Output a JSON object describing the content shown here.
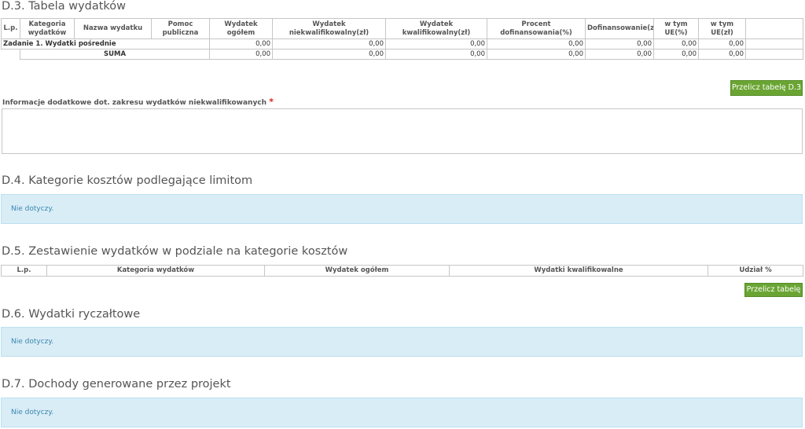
{
  "d3": {
    "title": "D.3. Tabela wydatków",
    "headers": [
      "L.p.",
      "Kategoria wydatków",
      "Nazwa wydatku",
      "Pomoc publiczna",
      "Wydatek ogółem",
      "Wydatek niekwalifikowalny(zł)",
      "Wydatek kwalifikowalny(zł)",
      "Procent dofinansowania(%)",
      "Dofinansowanie(zł)",
      "w tym UE(%)",
      "w tym UE(zł)"
    ],
    "task_row": {
      "label": "Zadanie 1. Wydatki pośrednie",
      "values": [
        "0,00",
        "0,00",
        "0,00",
        "0,00",
        "0,00",
        "0,00",
        "0,00"
      ]
    },
    "sum_row": {
      "label": "SUMA",
      "values": [
        "0,00",
        "0,00",
        "0,00",
        "0,00",
        "0,00",
        "0,00",
        "0,00"
      ]
    },
    "recalc_button": "Przelicz tabelę D.3"
  },
  "extra_info": {
    "label": "Informacje dodatkowe dot. zakresu wydatków niekwalifikowanych",
    "required_mark": "*",
    "value": ""
  },
  "d4": {
    "title": "D.4. Kategorie kosztów podlegające limitom",
    "note": "Nie dotyczy."
  },
  "d5": {
    "title": "D.5. Zestawienie wydatków w podziale na kategorie kosztów",
    "headers": [
      "L.p.",
      "Kategoria wydatków",
      "Wydatek ogółem",
      "Wydatki kwalifikowalne",
      "Udział %"
    ],
    "recalc_button": "Przelicz tabelę"
  },
  "d6": {
    "title": "D.6. Wydatki ryczałtowe",
    "note": "Nie dotyczy."
  },
  "d7": {
    "title": "D.7. Dochody generowane przez projekt",
    "note": "Nie dotyczy."
  }
}
